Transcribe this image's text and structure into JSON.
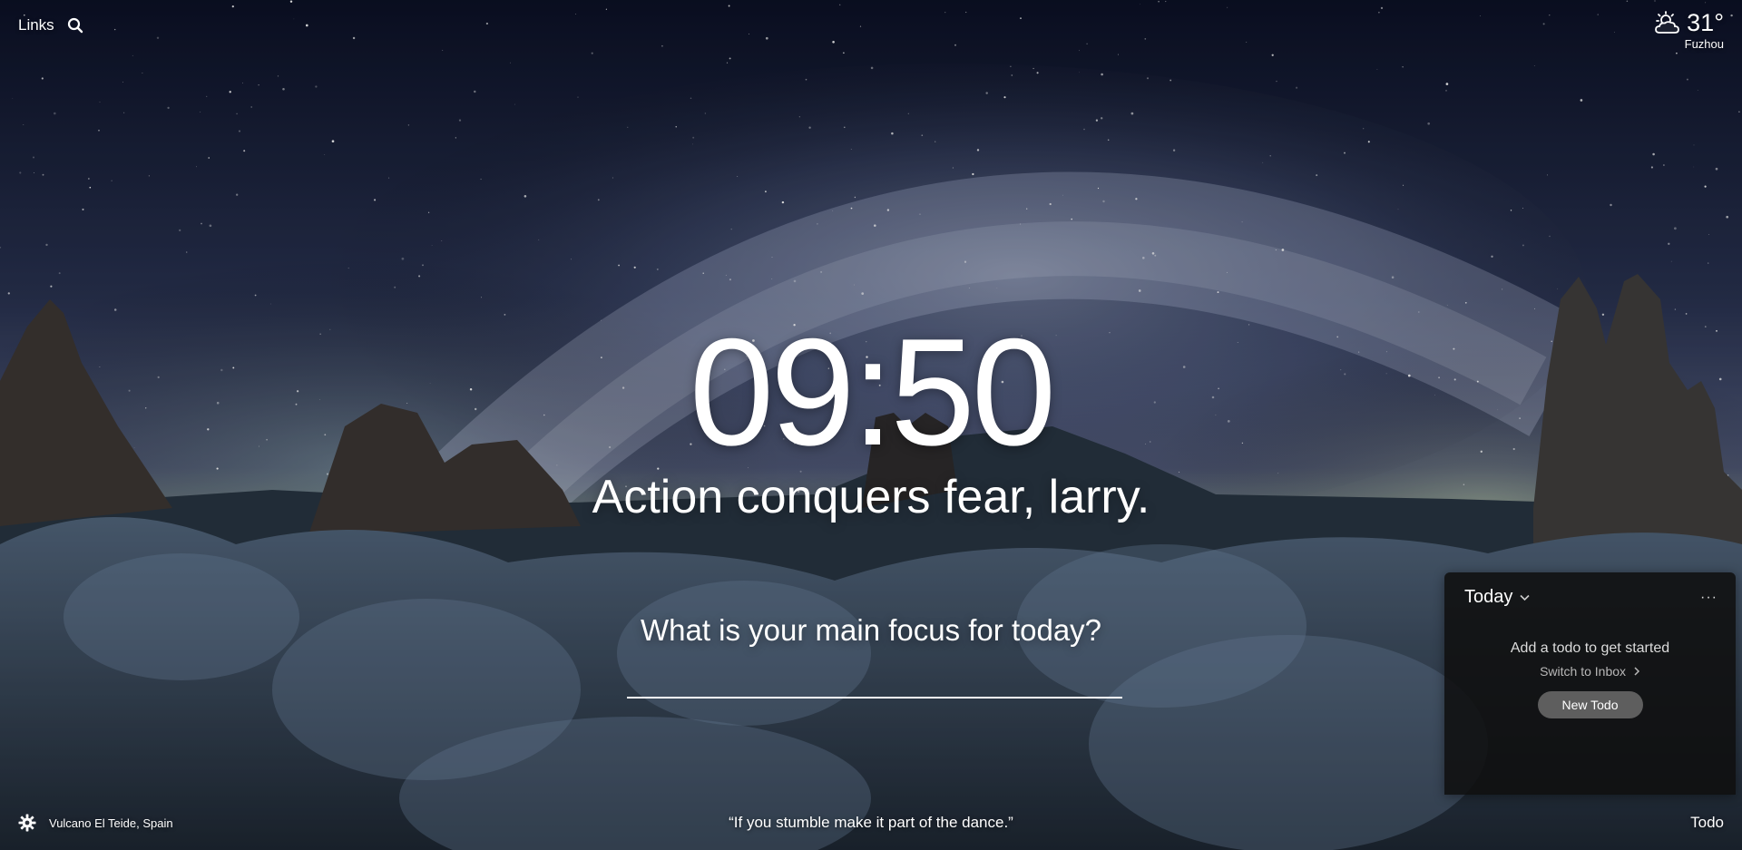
{
  "top": {
    "links_label": "Links",
    "search_icon": "search-icon"
  },
  "weather": {
    "temp": "31°",
    "city": "Fuzhou",
    "icon": "partly-cloudy-icon"
  },
  "clock": {
    "time": "09:50"
  },
  "greeting": {
    "text": "Action conquers fear, larry."
  },
  "focus": {
    "prompt": "What is your main focus for today?",
    "value": ""
  },
  "todo": {
    "title": "Today",
    "more": "···",
    "empty_text": "Add a todo to get started",
    "switch_label": "Switch to Inbox",
    "new_button": "New Todo",
    "toggle_label": "Todo"
  },
  "bottom": {
    "location": "Vulcano El Teide, Spain",
    "quote": "“If you stumble make it part of the dance.”",
    "settings_icon": "gear-icon"
  },
  "colors": {
    "sky_top": "#0d1226",
    "sky_mid": "#3a4566",
    "horizon": "#7f8a8a",
    "ground": "#1d2a33",
    "panel_bg": "#0f0f0f",
    "button_bg": "#5e5e5e"
  }
}
